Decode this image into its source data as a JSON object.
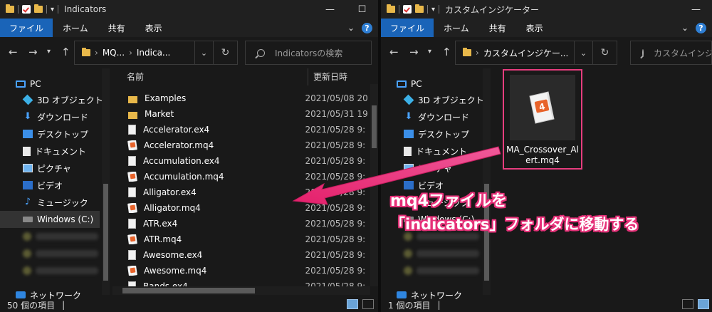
{
  "left": {
    "title": "Indicators",
    "tabs": [
      "ファイル",
      "ホーム",
      "共有",
      "表示"
    ],
    "address": {
      "seg1": "MQ...",
      "seg2": "Indica..."
    },
    "search_placeholder": "Indicatorsの検索",
    "columns": {
      "name": "名前",
      "date": "更新日時"
    },
    "files": [
      {
        "name": "Examples",
        "type": "folder",
        "date": "2021/05/08 20"
      },
      {
        "name": "Market",
        "type": "folder",
        "date": "2021/05/31 19"
      },
      {
        "name": "Accelerator.ex4",
        "type": "ex4",
        "date": "2021/05/28 9:"
      },
      {
        "name": "Accelerator.mq4",
        "type": "mq4",
        "date": "2021/05/28 9:"
      },
      {
        "name": "Accumulation.ex4",
        "type": "ex4",
        "date": "2021/05/28 9:"
      },
      {
        "name": "Accumulation.mq4",
        "type": "mq4",
        "date": "2021/05/28 9:"
      },
      {
        "name": "Alligator.ex4",
        "type": "ex4",
        "date": "2021/05/28 9:"
      },
      {
        "name": "Alligator.mq4",
        "type": "mq4",
        "date": "2021/05/28 9:"
      },
      {
        "name": "ATR.ex4",
        "type": "ex4",
        "date": "2021/05/28 9:"
      },
      {
        "name": "ATR.mq4",
        "type": "mq4",
        "date": "2021/05/28 9:"
      },
      {
        "name": "Awesome.ex4",
        "type": "ex4",
        "date": "2021/05/28 9:"
      },
      {
        "name": "Awesome.mq4",
        "type": "mq4",
        "date": "2021/05/28 9:"
      },
      {
        "name": "Bands.ex4",
        "type": "ex4",
        "date": "2021/05/28 9:"
      }
    ],
    "status": "50 個の項目",
    "status_sep": "|"
  },
  "right": {
    "title": "カスタムインジケーター",
    "tabs": [
      "ファイル",
      "ホーム",
      "共有",
      "表示"
    ],
    "address": {
      "seg1": "カスタムインジケー..."
    },
    "search_placeholder": "カスタムインジケーター",
    "file": {
      "name_line1": "MA_Crossover_Al",
      "name_line2": "ert.mq4"
    },
    "status": "1 個の項目",
    "status_sep": "|"
  },
  "nav": {
    "pc": "PC",
    "items": [
      "3D オブジェクト",
      "ダウンロード",
      "デスクトップ",
      "ドキュメント",
      "ピクチャ",
      "ビデオ",
      "ミュージック"
    ],
    "drive": "Windows (C:)",
    "network": "ネットワーク"
  },
  "annotation": {
    "line1": "mq4ファイルを",
    "line2": "「indicators」フォルダに移動する"
  },
  "colors": {
    "accent": "#1a64b8",
    "highlight": "#e63d7e"
  }
}
